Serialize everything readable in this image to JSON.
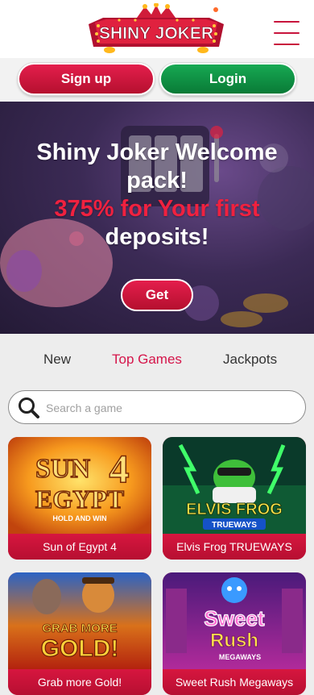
{
  "header": {
    "logo_text": "SHINY JOKER"
  },
  "auth": {
    "signup_label": "Sign up",
    "login_label": "Login"
  },
  "hero": {
    "line1": "Shiny Joker Welcome",
    "line2": "pack!",
    "line3": "375% for Your first",
    "line4": "deposits!",
    "cta_label": "Get"
  },
  "tabs": [
    {
      "label": "New",
      "active": false
    },
    {
      "label": "Top Games",
      "active": true
    },
    {
      "label": "Jackpots",
      "active": false
    }
  ],
  "search": {
    "placeholder": "Search a game"
  },
  "games": [
    {
      "title": "Sun of Egypt 4",
      "art_line1": "SUN",
      "art_line2": "EGYPT",
      "art_num": "4",
      "art_sub": "HOLD AND WIN"
    },
    {
      "title": "Elvis Frog TRUEWAYS",
      "art_line1": "ELVIS FROG",
      "art_sub": "TRUEWAYS"
    },
    {
      "title": "Grab more Gold!",
      "art_line1": "GRAB MORE",
      "art_line2": "GOLD!"
    },
    {
      "title": "Sweet Rush Megaways",
      "art_line1": "Sweet",
      "art_line2": "Rush",
      "art_sub": "MEGAWAYS"
    }
  ],
  "colors": {
    "brand_red": "#c8143c",
    "login_green": "#0e9444",
    "active_tab": "#d5154a"
  }
}
